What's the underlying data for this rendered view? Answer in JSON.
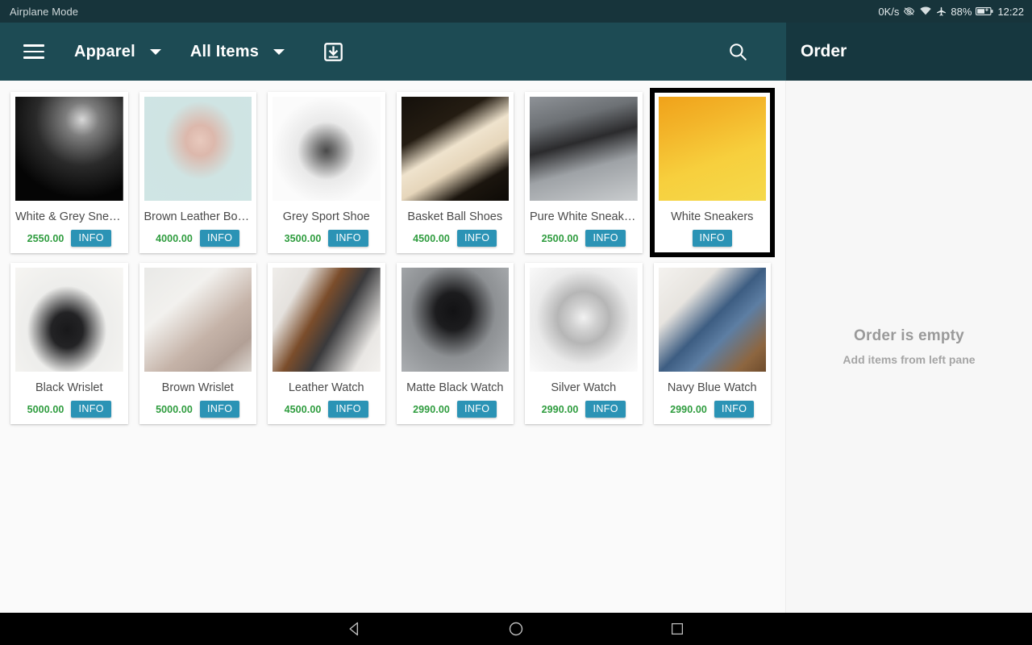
{
  "status_bar": {
    "left_text": "Airplane Mode",
    "network_speed": "0K/s",
    "icons": [
      "eye-icon",
      "wifi-icon",
      "airplane-icon"
    ],
    "battery_percent": "88%",
    "battery_icon": "battery-charging-icon",
    "clock": "12:22"
  },
  "app_bar": {
    "menu_icon": "hamburger-menu-icon",
    "category_spinner": "Apparel",
    "filter_spinner": "All Items",
    "download_icon": "download-box-icon",
    "search_icon": "search-icon",
    "order_panel_title": "Order"
  },
  "order_panel": {
    "empty_title": "Order is empty",
    "empty_subtitle": "Add items from left pane"
  },
  "colors": {
    "appbar_left": "#1d4b54",
    "appbar_right": "#16373f",
    "statusbar": "#17343b",
    "price_green": "#2e9c3e",
    "info_button_teal": "#2b93b5",
    "page_background": "#fafafa",
    "selection_border": "#000000"
  },
  "buttons": {
    "info_label": "INFO"
  },
  "products": [
    {
      "name": "White & Grey Sneaker",
      "price": "2550.00",
      "selected": false,
      "image": "sneaker-black-white-on-dark",
      "thumb_css": "radial-gradient(circle at 62% 22%, #d8d8d8 0%, #7d7d7d 16%, #2a2a2a 44%, #050505 75%)"
    },
    {
      "name": "Brown Leather Boots",
      "price": "4000.00",
      "selected": false,
      "image": "pink-boot-held-by-hand-on-mint",
      "thumb_css": "radial-gradient(ellipse at 52% 42%, #e8c9bd 0%, #dcb8ac 18%, #cfe4e3 46%, #cfe5e4 100%)"
    },
    {
      "name": "Grey Sport Shoe",
      "price": "3500.00",
      "selected": false,
      "image": "grey-running-shoe-on-white",
      "thumb_css": "radial-gradient(ellipse at 50% 52%, #4a4a4a 0%, #767676 12%, #e9e9e9 38%, #fbfbfb 70%)"
    },
    {
      "name": "Basket Ball Shoes",
      "price": "4500.00",
      "selected": false,
      "image": "cream-sneaker-red-swoosh-dark-bg",
      "thumb_css": "linear-gradient(150deg, #14100b 0%, #241c12 30%, #efe3cd 48%, #e6d6bb 62%, #1b150e 80%, #0d0a06 100%)"
    },
    {
      "name": "Pure White Sneakers",
      "price": "2500.00",
      "selected": false,
      "image": "person-with-white-sneakers-and-bag",
      "thumb_css": "linear-gradient(165deg, #8e9297 0%, #6d7175 24%, #2b2b2d 44%, #9ea2a6 66%, #c9ccce 100%)"
    },
    {
      "name": "White Sneakers",
      "price": "",
      "selected": true,
      "image": "white-sneakers-on-yellow-orange-bg",
      "thumb_css": "linear-gradient(160deg, #f0a21a 0%, #f3b52a 28%, #f7cf3d 60%, #f5d94a 100%)"
    },
    {
      "name": "Black Wrislet",
      "price": "5000.00",
      "selected": false,
      "image": "black-wristlet-bag-on-white-fabric",
      "thumb_css": "radial-gradient(ellipse at 48% 60%, #18181a 0%, #232325 20%, #ededeb 50%, #f7f6f3 100%)"
    },
    {
      "name": "Brown Wrislet",
      "price": "5000.00",
      "selected": false,
      "image": "taupe-wristlet-bag-with-magazine",
      "thumb_css": "linear-gradient(140deg, #e9e9e7 0%, #f2f1ee 32%, #c5b3a8 62%, #b2a096 82%, #ddd8d2 100%)"
    },
    {
      "name": "Leather Watch",
      "price": "4500.00",
      "selected": false,
      "image": "two-leather-strap-watches-on-marble",
      "thumb_css": "linear-gradient(120deg, #efedea 0%, #e5e2de 22%, #7b4d2b 42%, #3a3a3c 58%, #e9e7e4 84%, #f3f1ee 100%)"
    },
    {
      "name": "Matte Black Watch",
      "price": "2990.00",
      "selected": false,
      "image": "matte-black-watch-on-grey-fabric",
      "thumb_css": "radial-gradient(ellipse at 48% 42%, #121214 0%, #1c1c1e 22%, #8d9093 54%, #aeb1b4 100%)"
    },
    {
      "name": "Silver Watch",
      "price": "2990.00",
      "selected": false,
      "image": "silver-chronograph-watch-on-white",
      "thumb_css": "radial-gradient(ellipse at 50% 48%, #f2f2f2 0%, #cfcfcf 18%, #b6b6b6 34%, #eaeaea 62%, #fbfbfb 100%)"
    },
    {
      "name": "Navy Blue Watch",
      "price": "2990.00",
      "selected": false,
      "image": "navy-blue-strap-watch-on-leather",
      "thumb_css": "linear-gradient(135deg, #f4f2ef 0%, #e7e4df 28%, #3d5d82 50%, #5d7ea3 64%, #8d6640 86%, #6f4c2c 100%)"
    }
  ],
  "nav_bar": {
    "back": "back-triangle-icon",
    "home": "home-circle-icon",
    "recents": "recents-square-icon"
  }
}
